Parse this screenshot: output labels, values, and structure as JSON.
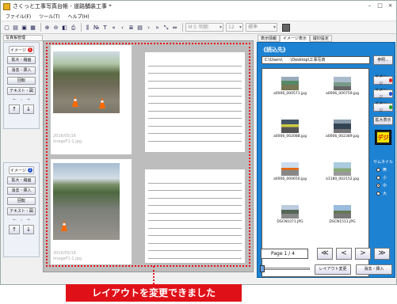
{
  "window": {
    "title": "さくっと工事写真台帳 - 道路舗装工事 *"
  },
  "menu": [
    "ファイル(F)",
    "ツール(T)",
    "ヘルプ(H)"
  ],
  "toolbar": {
    "font_name": "ＭＳ 明朝",
    "font_size": "12",
    "style": "標準",
    "color": "#666666"
  },
  "left_tab": "写真帳管理",
  "left_panels": [
    {
      "tag": "イメージ",
      "tag_color": "#e02020",
      "buttons": [
        "拡大・縮画",
        "消去・挿入",
        "回転",
        "テキスト・図"
      ]
    },
    {
      "tag": "イメージ",
      "tag_color": "#2050d0",
      "buttons": [
        "拡大・縮画",
        "消去・挿入",
        "回転",
        "テキスト・図"
      ]
    }
  ],
  "pages": [
    {
      "date": "2016/05/16",
      "file": "imageF1-1.jpg"
    },
    {
      "date": "2016/05/16",
      "file": "imageF1-1.jpg"
    }
  ],
  "right_tabs": [
    "表示情報",
    "イメージ表示",
    "縦印設定"
  ],
  "right_panel": {
    "heading": "《読込先》",
    "path": "C:\\Users\\　　\\Desktop\\工事写真",
    "browse_button": "参照...",
    "thumbnails": [
      "a0006_000571.jpg",
      "a0006_000759.jpg",
      "a0006_002088.jpg",
      "a0006_002389.jpg",
      "a0006_000650.jpg",
      "a1180_002152.jpg",
      "DSCN1071.JPG",
      "DSCN1511.JPG"
    ],
    "image_buttons": [
      {
        "label": "イメージ",
        "color": "#e02020"
      },
      {
        "label": "イメージ",
        "color": "#2050d0"
      },
      {
        "label": "イメージ",
        "color": "#20a020"
      }
    ],
    "zoom_button": "拡大表示",
    "digi_label": "デジ",
    "thumb_size_label": "サムネイル",
    "thumb_sizes": [
      "無",
      "小",
      "中",
      "大"
    ],
    "thumb_size_selected": "中",
    "page_text": "Page 1 / 4",
    "nav_buttons": [
      "≪",
      "<",
      ">",
      "≫"
    ],
    "layout_button": "レイアウト変更",
    "erase_button": "消去・挿入"
  },
  "banner": "レイアウトを変更できました"
}
